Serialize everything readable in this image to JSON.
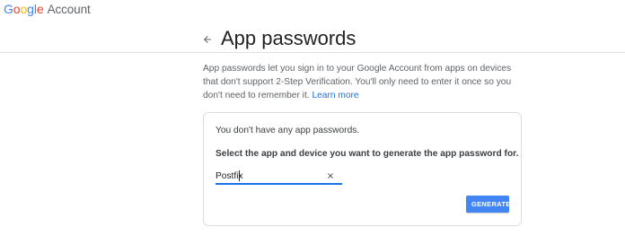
{
  "brand": {
    "logo_letters": [
      "G",
      "o",
      "o",
      "g",
      "l",
      "e"
    ],
    "logo_colors": [
      "#4285f4",
      "#ea4335",
      "#fbbc05",
      "#4285f4",
      "#34a853",
      "#ea4335"
    ],
    "product": "Account"
  },
  "header": {
    "back_icon": "arrow-left-icon",
    "title": "App passwords"
  },
  "intro": {
    "text": "App passwords let you sign in to your Google Account from apps on devices that don't support 2-Step Verification. You'll only need to enter it once so you don't need to remember it.",
    "link_label": "Learn more"
  },
  "card": {
    "empty_message": "You don't have any app passwords.",
    "select_label": "Select the app and device you want to generate the app password for.",
    "app_input": {
      "value": "Postfix",
      "clear_icon": "close-icon"
    },
    "generate_label": "GENERATE"
  },
  "colors": {
    "accent": "#1a73e8",
    "button": "#4285f4"
  }
}
